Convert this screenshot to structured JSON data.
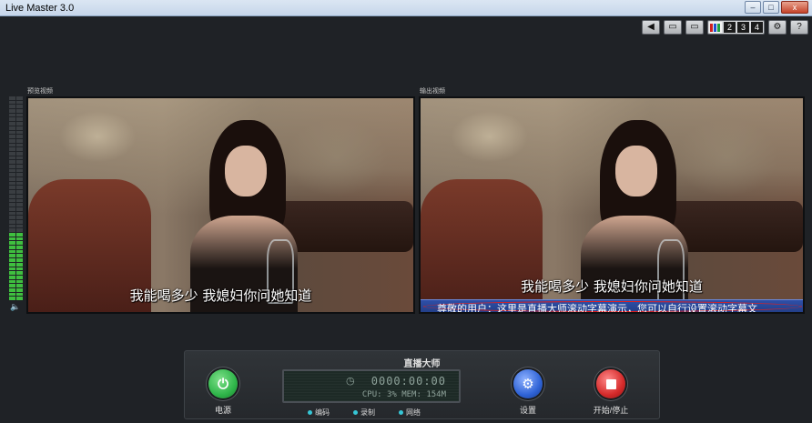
{
  "window": {
    "title": "Live Master 3.0",
    "controls": {
      "minimize": "–",
      "maximize": "□",
      "close": "x"
    }
  },
  "toolbar": {
    "icons": [
      "speaker-icon",
      "monitor-icon",
      "screen-icon",
      "channel-bars-icon",
      "gear-icon",
      "help-icon"
    ],
    "mute": "◀",
    "monitor1": "▭",
    "monitor2": "▭",
    "channels": [
      "2",
      "3",
      "4"
    ],
    "settings": "⚙",
    "help": "?"
  },
  "preview": {
    "label": "预览视频",
    "subtitle": "我能喝多少 我媳妇你问她知道"
  },
  "output": {
    "label": "输出视频",
    "subtitle": "我能喝多少 我媳妇你问她知道",
    "ticker": "尊敬的用户：这里是直播大师滚动字幕演示，您可以自行设置滚动字幕文"
  },
  "audio": {
    "speaker": "🔈"
  },
  "panel": {
    "title": "直播大师",
    "power_label": "电源",
    "settings_label": "设置",
    "start_stop_label": "开始/停止",
    "time": "0000:00:00",
    "clock": "◷",
    "cpu_mem": "CPU:  3%  MEM: 154M",
    "indicators": [
      "编码",
      "录制",
      "网络"
    ]
  },
  "colors": {
    "power": "#2fb54a",
    "settings": "#2f63d6",
    "stop": "#d52a2a",
    "indicator": "#36c6d6",
    "meter": "#3fbf3f"
  }
}
